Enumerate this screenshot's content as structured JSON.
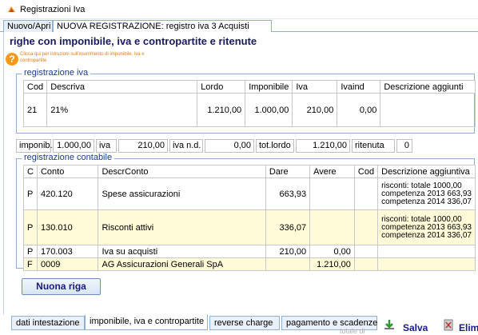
{
  "window": {
    "title": "Registrazioni Iva"
  },
  "top_tabs": [
    {
      "label": "Nuovo/Apri"
    },
    {
      "label": "NUOVA REGISTRAZIONE: registro iva 3 Acquisti"
    }
  ],
  "section": {
    "heading": "righe con imponibile, iva e contropartite e ritenute",
    "help_text": "Clicca qui per istruzioni sull'inserimento di imponibile, iva e contropartite"
  },
  "registrazione_iva": {
    "legend": "registrazione iva",
    "headers": [
      "Cod",
      "Descriva",
      "Lordo",
      "Imponibile",
      "Iva",
      "Ivaind",
      "Descrizione aggiunti"
    ],
    "rows": [
      {
        "cod": "21",
        "descriva": "21%",
        "lordo": "1.210,00",
        "imponibile": "1.000,00",
        "iva": "210,00",
        "ivaind": "0,00",
        "descr": ""
      }
    ]
  },
  "summary": {
    "imponib_label": "imponib.",
    "imponib_value": "1.000,00",
    "iva_label": "iva",
    "iva_value": "210,00",
    "ivand_label": "iva n.d.",
    "ivand_value": "0,00",
    "totlordo_label": "tot.lordo",
    "totlordo_value": "1.210,00",
    "ritenuta_label": "ritenuta",
    "ritenuta_value": "0"
  },
  "registrazione_contabile": {
    "legend": "registrazione contabile",
    "headers": [
      "C",
      "Conto",
      "DescrConto",
      "Dare",
      "Avere",
      "Cod",
      "Descrizione aggiuntiva"
    ],
    "rows": [
      {
        "c": "P",
        "conto": "420.120",
        "descr": "Spese assicurazioni",
        "dare": "663,93",
        "avere": "",
        "cod": "",
        "agg1": "risconti: totale 1000,00",
        "agg2": "competenza 2013 663,93",
        "agg3": "competenza 2014 336,07"
      },
      {
        "c": "P",
        "conto": "130.010",
        "descr": "Risconti attivi",
        "dare": "336,07",
        "avere": "",
        "cod": "",
        "agg1": "risconti: totale 1000,00",
        "agg2": "competenza 2013 663,93",
        "agg3": "competenza 2014 336,07"
      },
      {
        "c": "P",
        "conto": "170.003",
        "descr": "Iva su acquisti",
        "dare": "210,00",
        "avere": "0,00",
        "cod": "",
        "agg1": ""
      },
      {
        "c": "F",
        "conto": "0009",
        "descr": "AG Assicurazioni Generali SpA",
        "dare": "",
        "avere": "1.210,00",
        "cod": "",
        "agg1": ""
      }
    ]
  },
  "nuova_riga_label": "Nuona riga",
  "bottom_tabs": [
    {
      "label": "dati intestazione"
    },
    {
      "label": "imponibile, iva e contropartite"
    },
    {
      "label": "reverse charge"
    },
    {
      "label": "pagamento e scadenze"
    }
  ],
  "footer": {
    "totale_label": "totale di",
    "salva_label": "Salva",
    "elimina_label": "Elim"
  }
}
